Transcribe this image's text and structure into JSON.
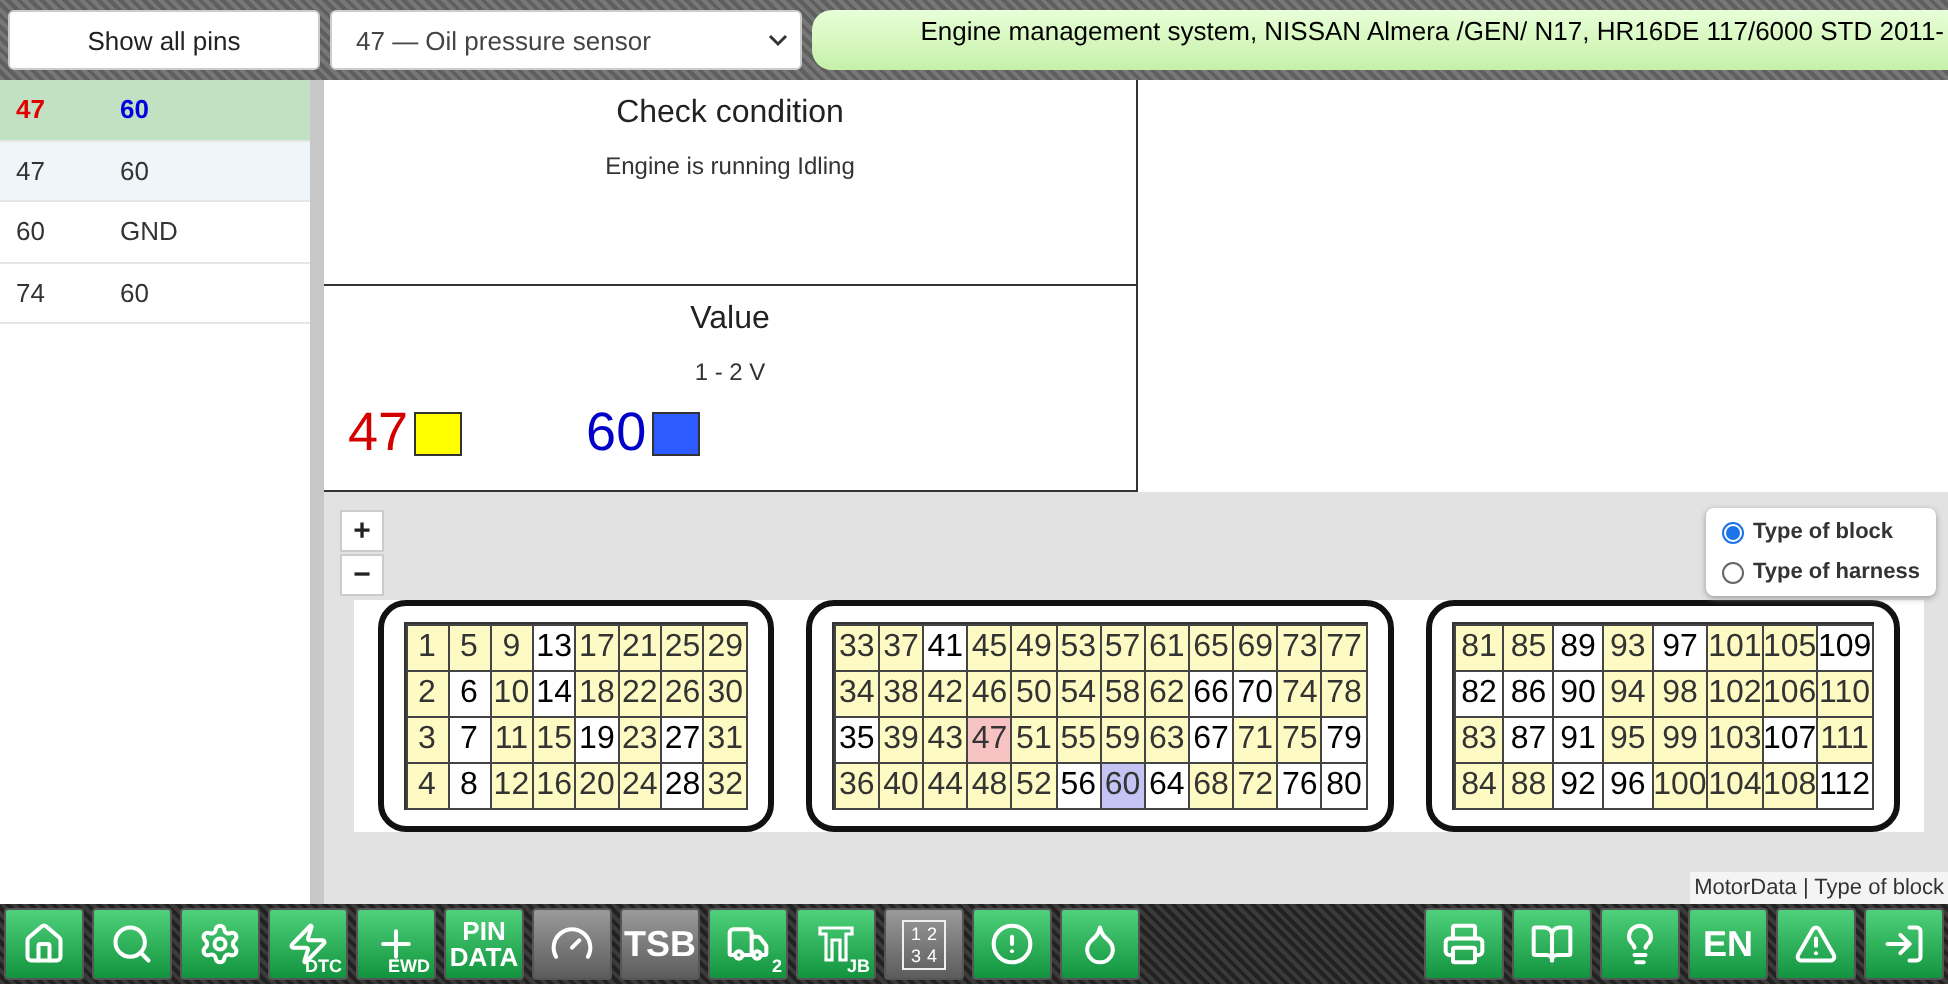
{
  "top_bar": {
    "show_all_button": "Show all pins",
    "pin_select": {
      "value": "47 — Oil pressure sensor"
    },
    "title": "Engine management system, NISSAN Almera /GEN/ N17, HR16DE 117/6000 STD 2011-"
  },
  "pin_pairs": [
    {
      "pin_a": "47",
      "pin_b": "60",
      "selected": true,
      "hovered": false
    },
    {
      "pin_a": "47",
      "pin_b": "60",
      "selected": false,
      "hovered": true
    },
    {
      "pin_a": "60",
      "pin_b": "GND",
      "selected": false,
      "hovered": false
    },
    {
      "pin_a": "74",
      "pin_b": "60",
      "selected": false,
      "hovered": false
    }
  ],
  "check_condition": {
    "title": "Check condition",
    "text": "Engine is running Idling"
  },
  "value": {
    "title": "Value",
    "text": "1 - 2 V",
    "probes": [
      {
        "label": "47",
        "kind": "positive"
      },
      {
        "label": "60",
        "kind": "negative"
      }
    ]
  },
  "zoom_controls": [
    "+",
    "−"
  ],
  "view_options": [
    {
      "label": "Type of block",
      "selected": true
    },
    {
      "label": "Type of harness",
      "selected": false
    }
  ],
  "connectors": [
    {
      "columns": [
        [
          {
            "label": "1",
            "kind": "used"
          },
          {
            "label": "2",
            "kind": "used"
          },
          {
            "label": "3",
            "kind": "used"
          },
          {
            "label": "4",
            "kind": "used"
          }
        ],
        [
          {
            "label": "5",
            "kind": "used"
          },
          {
            "label": "6",
            "kind": "empty"
          },
          {
            "label": "7",
            "kind": "empty"
          },
          {
            "label": "8",
            "kind": "empty"
          }
        ],
        [
          {
            "label": "9",
            "kind": "used"
          },
          {
            "label": "10",
            "kind": "used"
          },
          {
            "label": "11",
            "kind": "used"
          },
          {
            "label": "12",
            "kind": "used"
          }
        ],
        [
          {
            "label": "13",
            "kind": "empty"
          },
          {
            "label": "14",
            "kind": "empty"
          },
          {
            "label": "15",
            "kind": "used"
          },
          {
            "label": "16",
            "kind": "used"
          }
        ],
        [
          {
            "label": "17",
            "kind": "used"
          },
          {
            "label": "18",
            "kind": "used"
          },
          {
            "label": "19",
            "kind": "empty"
          },
          {
            "label": "20",
            "kind": "used"
          }
        ],
        [
          {
            "label": "21",
            "kind": "used"
          },
          {
            "label": "22",
            "kind": "used"
          },
          {
            "label": "23",
            "kind": "used"
          },
          {
            "label": "24",
            "kind": "used"
          }
        ],
        [
          {
            "label": "25",
            "kind": "used"
          },
          {
            "label": "26",
            "kind": "used"
          },
          {
            "label": "27",
            "kind": "empty"
          },
          {
            "label": "28",
            "kind": "empty"
          }
        ],
        [
          {
            "label": "29",
            "kind": "used"
          },
          {
            "label": "30",
            "kind": "used"
          },
          {
            "label": "31",
            "kind": "used"
          },
          {
            "label": "32",
            "kind": "used"
          }
        ]
      ]
    },
    {
      "columns": [
        [
          {
            "label": "33",
            "kind": "used"
          },
          {
            "label": "34",
            "kind": "used"
          },
          {
            "label": "35",
            "kind": "empty"
          },
          {
            "label": "36",
            "kind": "used"
          }
        ],
        [
          {
            "label": "37",
            "kind": "used"
          },
          {
            "label": "38",
            "kind": "used"
          },
          {
            "label": "39",
            "kind": "used"
          },
          {
            "label": "40",
            "kind": "used"
          }
        ],
        [
          {
            "label": "41",
            "kind": "empty"
          },
          {
            "label": "42",
            "kind": "used"
          },
          {
            "label": "43",
            "kind": "used"
          },
          {
            "label": "44",
            "kind": "used"
          }
        ],
        [
          {
            "label": "45",
            "kind": "used"
          },
          {
            "label": "46",
            "kind": "used"
          },
          {
            "label": "47",
            "kind": "positive"
          },
          {
            "label": "48",
            "kind": "used"
          }
        ],
        [
          {
            "label": "49",
            "kind": "used"
          },
          {
            "label": "50",
            "kind": "used"
          },
          {
            "label": "51",
            "kind": "used"
          },
          {
            "label": "52",
            "kind": "used"
          }
        ],
        [
          {
            "label": "53",
            "kind": "used"
          },
          {
            "label": "54",
            "kind": "used"
          },
          {
            "label": "55",
            "kind": "used"
          },
          {
            "label": "56",
            "kind": "empty"
          }
        ],
        [
          {
            "label": "57",
            "kind": "used"
          },
          {
            "label": "58",
            "kind": "used"
          },
          {
            "label": "59",
            "kind": "used"
          },
          {
            "label": "60",
            "kind": "negative"
          }
        ],
        [
          {
            "label": "61",
            "kind": "used"
          },
          {
            "label": "62",
            "kind": "used"
          },
          {
            "label": "63",
            "kind": "used"
          },
          {
            "label": "64",
            "kind": "empty"
          }
        ],
        [
          {
            "label": "65",
            "kind": "used"
          },
          {
            "label": "66",
            "kind": "empty"
          },
          {
            "label": "67",
            "kind": "empty"
          },
          {
            "label": "68",
            "kind": "used"
          }
        ],
        [
          {
            "label": "69",
            "kind": "used"
          },
          {
            "label": "70",
            "kind": "empty"
          },
          {
            "label": "71",
            "kind": "used"
          },
          {
            "label": "72",
            "kind": "used"
          }
        ],
        [
          {
            "label": "73",
            "kind": "used"
          },
          {
            "label": "74",
            "kind": "used"
          },
          {
            "label": "75",
            "kind": "used"
          },
          {
            "label": "76",
            "kind": "empty"
          }
        ],
        [
          {
            "label": "77",
            "kind": "used"
          },
          {
            "label": "78",
            "kind": "used"
          },
          {
            "label": "79",
            "kind": "empty"
          },
          {
            "label": "80",
            "kind": "empty"
          }
        ]
      ]
    },
    {
      "columns": [
        [
          {
            "label": "81",
            "kind": "used"
          },
          {
            "label": "82",
            "kind": "empty"
          },
          {
            "label": "83",
            "kind": "used"
          },
          {
            "label": "84",
            "kind": "used"
          }
        ],
        [
          {
            "label": "85",
            "kind": "used"
          },
          {
            "label": "86",
            "kind": "empty"
          },
          {
            "label": "87",
            "kind": "empty"
          },
          {
            "label": "88",
            "kind": "used"
          }
        ],
        [
          {
            "label": "89",
            "kind": "empty"
          },
          {
            "label": "90",
            "kind": "empty"
          },
          {
            "label": "91",
            "kind": "empty"
          },
          {
            "label": "92",
            "kind": "empty"
          }
        ],
        [
          {
            "label": "93",
            "kind": "used"
          },
          {
            "label": "94",
            "kind": "used"
          },
          {
            "label": "95",
            "kind": "used"
          },
          {
            "label": "96",
            "kind": "empty"
          }
        ],
        [
          {
            "label": "97",
            "kind": "empty"
          },
          {
            "label": "98",
            "kind": "used"
          },
          {
            "label": "99",
            "kind": "used"
          },
          {
            "label": "100",
            "kind": "used"
          }
        ],
        [
          {
            "label": "101",
            "kind": "used"
          },
          {
            "label": "102",
            "kind": "used"
          },
          {
            "label": "103",
            "kind": "used"
          },
          {
            "label": "104",
            "kind": "used"
          }
        ],
        [
          {
            "label": "105",
            "kind": "used"
          },
          {
            "label": "106",
            "kind": "used"
          },
          {
            "label": "107",
            "kind": "empty"
          },
          {
            "label": "108",
            "kind": "used"
          }
        ],
        [
          {
            "label": "109",
            "kind": "empty"
          },
          {
            "label": "110",
            "kind": "used"
          },
          {
            "label": "111",
            "kind": "used"
          },
          {
            "label": "112",
            "kind": "empty"
          }
        ]
      ]
    }
  ],
  "footer": "MotorData | Type of block",
  "toolbar_left": [
    {
      "kind": "home",
      "disabled": false
    },
    {
      "kind": "engine",
      "disabled": false
    },
    {
      "kind": "wheel",
      "disabled": false
    },
    {
      "kind": "dtc",
      "disabled": false,
      "labels": [
        "DTC"
      ]
    },
    {
      "kind": "ewd",
      "disabled": false,
      "labels": [
        "EWD"
      ]
    },
    {
      "kind": "pindata",
      "disabled": false,
      "labels": [
        "PIN",
        "DATA"
      ]
    },
    {
      "kind": "meter",
      "disabled": true
    },
    {
      "kind": "tsb",
      "disabled": true,
      "labels": [
        "TSB"
      ]
    },
    {
      "kind": "lift",
      "disabled": false,
      "labels": [
        "2"
      ]
    },
    {
      "kind": "jb",
      "disabled": false,
      "labels": [
        "JB"
      ]
    },
    {
      "kind": "fuse",
      "disabled": true,
      "labels": [
        "1",
        "2",
        "3",
        "4"
      ]
    },
    {
      "kind": "alert",
      "disabled": false
    },
    {
      "kind": "oil",
      "disabled": false
    }
  ],
  "toolbar_right": [
    {
      "kind": "printer",
      "disabled": false
    },
    {
      "kind": "book",
      "disabled": false
    },
    {
      "kind": "bulb",
      "disabled": false
    },
    {
      "kind": "lang",
      "disabled": false,
      "labels": [
        "EN"
      ]
    },
    {
      "kind": "warning",
      "disabled": false
    },
    {
      "kind": "exit",
      "disabled": false
    }
  ]
}
